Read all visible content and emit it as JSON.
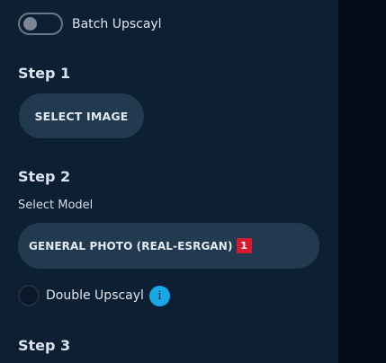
{
  "batch": {
    "label": "Batch Upscayl",
    "enabled": false
  },
  "step1": {
    "title": "Step 1",
    "button_label": "SELECT IMAGE"
  },
  "step2": {
    "title": "Step 2",
    "model_label": "Select Model",
    "model_value": "GENERAL PHOTO (REAL-ESRGAN)",
    "model_badge": "1",
    "double_upscayl_label": "Double Upscayl",
    "double_upscayl_checked": false,
    "info_icon": "info-icon"
  },
  "step3": {
    "title": "Step 3"
  },
  "colors": {
    "sidebar_bg": "#0d1f33",
    "button_bg": "#213a50",
    "badge_red": "#d51b30",
    "info_blue": "#1aa7e6"
  }
}
